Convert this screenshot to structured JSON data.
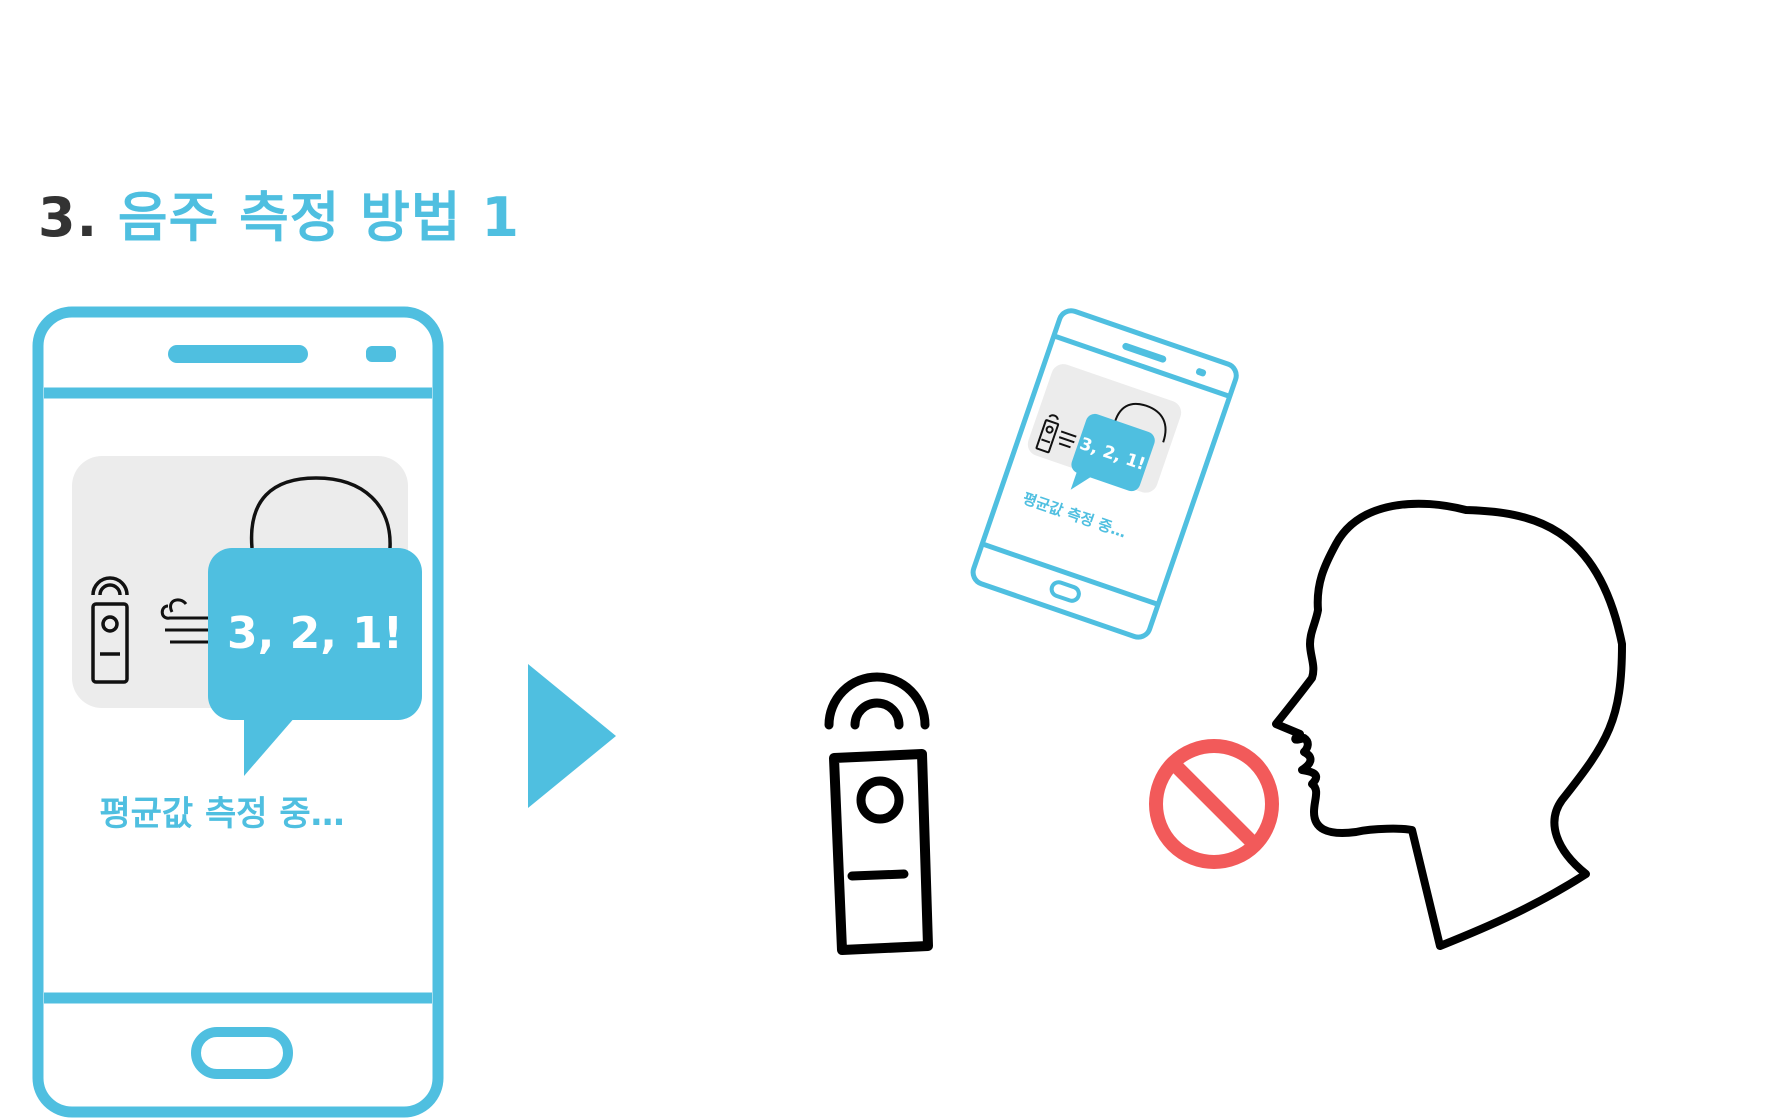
{
  "colors": {
    "accent": "#4fbfe0",
    "title_number": "#333333",
    "line": "#000000",
    "prohibit": "#f25a5a",
    "card_background": "#ececec",
    "background": "#ffffff"
  },
  "title": {
    "number": "3.",
    "text": "음주 측정 방법 1"
  },
  "app_screen": {
    "countdown": "3, 2, 1!",
    "status": "평균값 측정 중…"
  },
  "icons": [
    "smartphone-icon",
    "breathalyzer-icon",
    "wind-icon",
    "speech-bubble-icon",
    "play-arrow-icon",
    "head-profile-icon",
    "prohibit-icon"
  ]
}
